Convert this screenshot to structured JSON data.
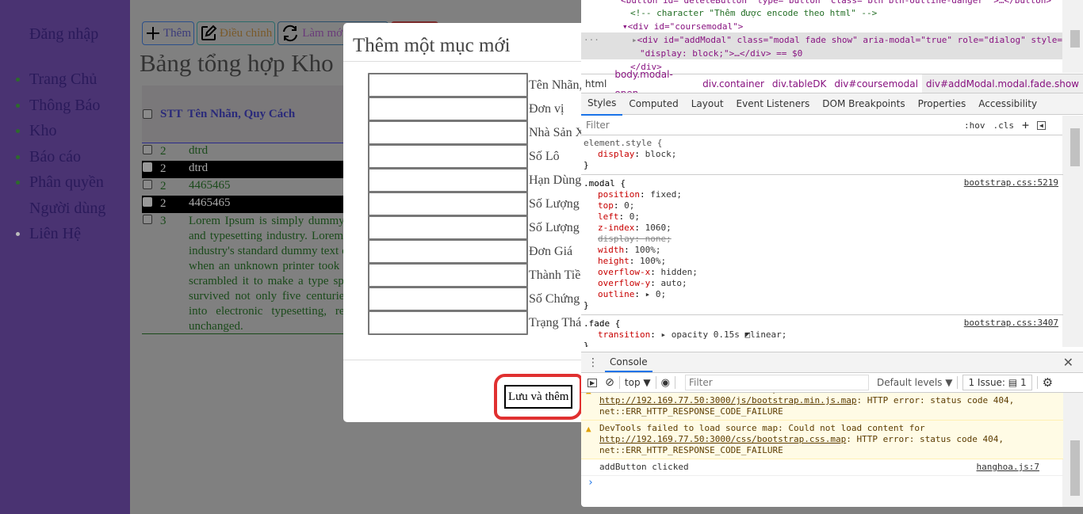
{
  "sidebar": {
    "login": "Đăng nhập",
    "items": [
      {
        "label": "Trang Chủ"
      },
      {
        "label": "Thông Báo"
      },
      {
        "label": "Kho"
      },
      {
        "label": "Báo cáo"
      },
      {
        "label": "Phân quyền Người dùng"
      },
      {
        "label": "Liên Hệ"
      }
    ]
  },
  "toolbar": {
    "add_label": "Thêm",
    "edit_label": "Điều chỉnh",
    "refresh_label": "Làm mới"
  },
  "page_title": "Bảng tổng hợp Kho",
  "table": {
    "headers": [
      "STT",
      "Tên Nhãn, Quy Cách"
    ],
    "rows": [
      {
        "stt": "2",
        "name": "dtrd"
      },
      {
        "stt": "2",
        "name": "dtrd"
      },
      {
        "stt": "2",
        "name": "4465465"
      },
      {
        "stt": "2",
        "name": "4465465"
      },
      {
        "stt": "3",
        "name": "Lorem Ipsum is simply dummy text of the printing and typesetting industry. Lorem Ipsum has been the industry's standard dummy text ever since the 1500s, when an unknown printer took a galley of type and scrambled it to make a type specimen book. It has survived not only five centuries, but also the leap into electronic typesetting, remaining essentially unchanged."
      }
    ]
  },
  "modal": {
    "title": "Thêm một mục mới",
    "fields": [
      {
        "label": "Tên Nhãn, Quy Cách",
        "value": ""
      },
      {
        "label": "Đơn vị",
        "value": ""
      },
      {
        "label": "Nhà Sản Xuất",
        "value": ""
      },
      {
        "label": "Số Lô",
        "value": ""
      },
      {
        "label": "Hạn Dùng",
        "value": ""
      },
      {
        "label": "Số Lượng",
        "value": ""
      },
      {
        "label": "Số Lượng",
        "value": ""
      },
      {
        "label": "Đơn Giá",
        "value": ""
      },
      {
        "label": "Thành Tiền",
        "value": ""
      },
      {
        "label": "Số Chứng",
        "value": ""
      },
      {
        "label": "Trạng Thái",
        "value": ""
      }
    ],
    "save_label": "Lưu và thêm"
  },
  "devtools": {
    "dom": {
      "line0": "<button id=\"deleteButton\" type=\"button\" class=\"btn btn-outline-danger\" >…</button>",
      "comment": "<!-- character \"Thêm được encode theo html\" -->",
      "coursemodal": "<div id=\"coursemodal\">",
      "selected_a": "<div id=\"addModal\" class=\"modal fade show\" aria-modal=\"true\" role=\"dialog\" style=",
      "selected_b": "\"display: block;\">…</div> == $0",
      "close": "</div>"
    },
    "breadcrumbs": [
      "html",
      "body.modal-open",
      "div.container",
      "div.tableDK",
      "div#coursemodal",
      "div#addModal.modal.fade.show"
    ],
    "tabs": [
      "Styles",
      "Computed",
      "Layout",
      "Event Listeners",
      "DOM Breakpoints",
      "Properties",
      "Accessibility"
    ],
    "styles_filter_placeholder": "Filter",
    "hov": ":hov",
    "cls": ".cls",
    "plus": "+",
    "rules": {
      "element_selector": "element.style {",
      "element_props": [
        {
          "n": "display",
          "v": "block;"
        }
      ],
      "modal_selector": ".modal {",
      "modal_src": "bootstrap.css:5219",
      "modal_props": [
        {
          "n": "position",
          "v": "fixed;"
        },
        {
          "n": "top",
          "v": "0;"
        },
        {
          "n": "left",
          "v": "0;"
        },
        {
          "n": "z-index",
          "v": "1060;"
        },
        {
          "n": "display",
          "v": "none;"
        },
        {
          "n": "width",
          "v": "100%;"
        },
        {
          "n": "height",
          "v": "100%;"
        },
        {
          "n": "overflow-x",
          "v": "hidden;"
        },
        {
          "n": "overflow-y",
          "v": "auto;"
        },
        {
          "n": "outline",
          "v": "▸ 0;"
        }
      ],
      "fade_selector": ".fade {",
      "fade_src": "bootstrap.css:3407",
      "fade_props": [
        {
          "n": "transition",
          "v": "▸ opacity 0.15s ◩linear;"
        }
      ]
    },
    "console": {
      "tab": "Console",
      "context": "top ▼",
      "filter_placeholder": "Filter",
      "levels": "Default levels ▼",
      "issues": "1 Issue: ▤ 1",
      "warn1_a": "DevTools failed to load source map: Could not load content for ",
      "warn1_link": "http://192.169.77.50:3000/js/bootstrap.min.js.map",
      "warn1_b": ": HTTP error: status code 404, net::ERR_HTTP_RESPONSE_CODE_FAILURE",
      "warn2_a": "DevTools failed to load source map: Could not load content for ",
      "warn2_link": "http://192.169.77.50:3000/css/bootstrap.css.map",
      "warn2_b": ": HTTP error: status code 404, net::ERR_HTTP_RESPONSE_CODE_FAILURE",
      "log": "addButton clicked",
      "log_src": "hanghoa.js:7",
      "prompt": "›"
    }
  }
}
